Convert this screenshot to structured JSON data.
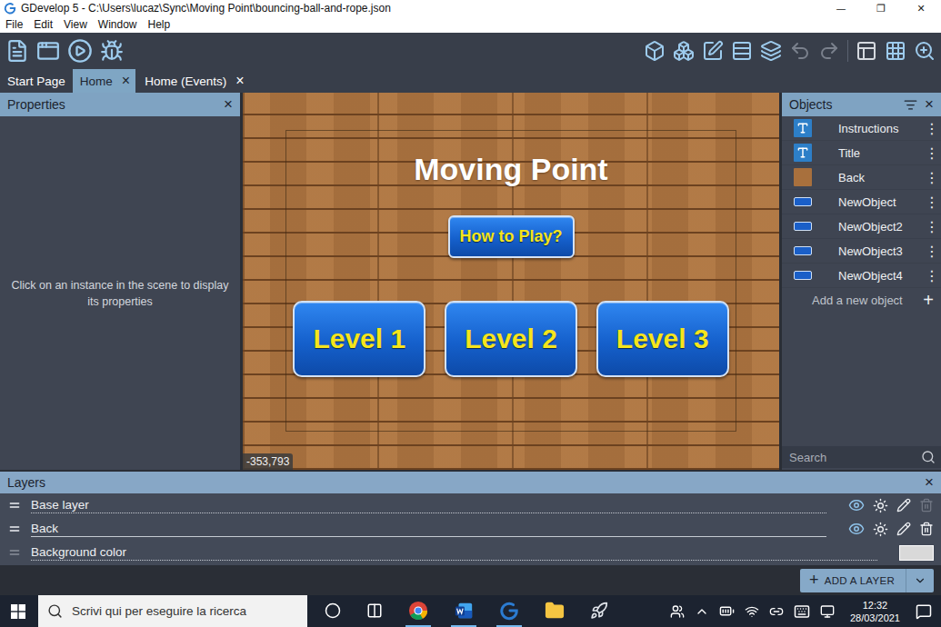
{
  "window": {
    "title": "GDevelop 5 - C:\\Users\\lucaz\\Sync\\Moving Point\\bouncing-ball-and-rope.json",
    "controls": [
      "—",
      "❐",
      "✕"
    ]
  },
  "menu": [
    "File",
    "Edit",
    "View",
    "Window",
    "Help"
  ],
  "tabs": [
    {
      "label": "Start Page",
      "selected": false,
      "closable": false
    },
    {
      "label": "Home",
      "selected": true,
      "closable": true
    },
    {
      "label": "Home (Events)",
      "selected": false,
      "closable": true
    }
  ],
  "close_glyph": "×",
  "properties": {
    "title": "Properties",
    "empty_text": "Click on an instance in the scene to display its properties"
  },
  "scene": {
    "title": "Moving Point",
    "buttons": [
      {
        "label": "How to Play?",
        "kind": "small"
      },
      {
        "label": "Level 1",
        "kind": "large"
      },
      {
        "label": "Level 2",
        "kind": "large"
      },
      {
        "label": "Level 3",
        "kind": "large"
      }
    ],
    "coordinates": "-353,793"
  },
  "objects": {
    "title": "Objects",
    "items": [
      {
        "name": "Instructions",
        "kind": "text"
      },
      {
        "name": "Title",
        "kind": "text"
      },
      {
        "name": "Back",
        "kind": "sprite"
      },
      {
        "name": "NewObject",
        "kind": "button"
      },
      {
        "name": "NewObject2",
        "kind": "button"
      },
      {
        "name": "NewObject3",
        "kind": "button"
      },
      {
        "name": "NewObject4",
        "kind": "button"
      }
    ],
    "menu_glyph": "⋮",
    "add_label": "Add a new object",
    "add_glyph": "+",
    "search_placeholder": "Search"
  },
  "layers": {
    "title": "Layers",
    "items": [
      {
        "name": "Base layer",
        "kind": "layer",
        "visible": true,
        "deletable": false
      },
      {
        "name": "Back",
        "kind": "layer",
        "visible": true,
        "deletable": true
      },
      {
        "name": "Background color",
        "kind": "background",
        "color": "#d9d9d9"
      }
    ],
    "add_button": "ADD A LAYER",
    "add_glyph": "+"
  },
  "taskbar": {
    "search_placeholder": "Scrivi qui per eseguire la ricerca",
    "time": "12:32",
    "date": "28/03/2021"
  }
}
